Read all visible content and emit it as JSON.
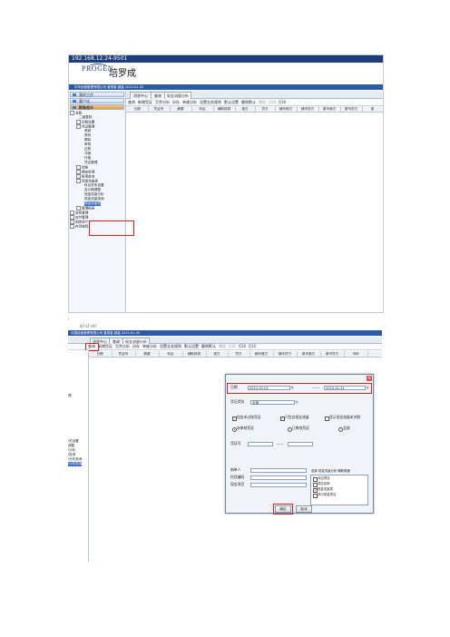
{
  "shot1": {
    "window_title": "192.168.12.24-9501",
    "logo_en": "PROGEN",
    "logo_cn": "培罗成",
    "info_bar": "中华经营管理有限公司 普测客 超级 2015-01-30",
    "nav": {
      "my_work": "我的工作",
      "customer": "客户化",
      "finance": "财务会计"
    },
    "tree": [
      "总账",
      "二级复制",
      "初始设置",
      "凭证管理",
      "录制",
      "修改",
      "删除",
      "审核",
      "过账",
      "冲销",
      "作废",
      "凭证管理",
      "结账",
      "期末处理",
      "账簿查询",
      "现金流量表",
      "科目关系设置",
      "会计期调整",
      "现金流量分析",
      "现金流量查询",
      "现金流量表",
      "管理报表",
      "应收管理",
      "应付管理",
      "固定资产",
      "存货核算"
    ],
    "tabs": [
      "消息中心",
      "查询",
      "现金流量分析"
    ],
    "toolbar": [
      "查询",
      "新增凭证",
      "冗余分析",
      "另存",
      "单维分析",
      "设置业务规则",
      "默认设置",
      "删除默认",
      "预览",
      "打印",
      "打印"
    ],
    "grid_headers": [
      "日期",
      "凭证号",
      "摘要",
      "科目",
      "辅助核算",
      "借方",
      "贷方",
      "辅币借方",
      "辅币贷方",
      "原币借方",
      "原币贷方",
      "原"
    ]
  },
  "separator": {
    "mark": "\\",
    "text": "IEI SF HIF"
  },
  "shot2": {
    "top_bar": "中国经营管理有限公司 普测客 超级 2015-01-30",
    "tabs": [
      "消息中心",
      "查询",
      "现金流量分析"
    ],
    "toolbar": [
      "查询",
      "新增凭证",
      "冗余分析",
      "另存",
      "单维分析",
      "设置业务规则",
      "默认设置",
      "删除默认",
      "预览",
      "打印",
      "打印",
      "打印"
    ],
    "grid_headers": [
      "日期",
      "凭证号",
      "摘要",
      "科目",
      "辅助核算",
      "借方",
      "贷方",
      "辅币借方",
      "辅币贷方",
      "原币借方",
      "原币贷方",
      "币种"
    ],
    "left_items": [
      "理",
      "l关设置",
      "调整",
      "l分析",
      "l查询",
      "l分析查询",
      "l分析查询"
    ],
    "dialog": {
      "date_label": "日期",
      "date_from": "2015-01-01",
      "date_dash": "——",
      "date_to": "2015-01-31",
      "voucher_type_label": "凭证类别",
      "voucher_type_value": "全部",
      "chk_unposted": "包含未过账凭证",
      "chk_voided": "只包含现金流量",
      "chk_summary": "显示现金流量未关联",
      "radio_unreviewed": "未审核凭证",
      "radio_reviewed": "已审核凭证",
      "radio_all": "全部",
      "voucher_no_label": "凭证号",
      "voucher_no_dash": "——",
      "maker_label": "制单人",
      "account_label": "科目编码",
      "project_label": "现金项目",
      "list_header": "选择 现金流量分析  辅助明细",
      "list_items": [
        "对应项目",
        "项目名称",
        "现金流量表",
        "其中现金项目"
      ],
      "ok": "确定",
      "cancel": "取消"
    }
  }
}
